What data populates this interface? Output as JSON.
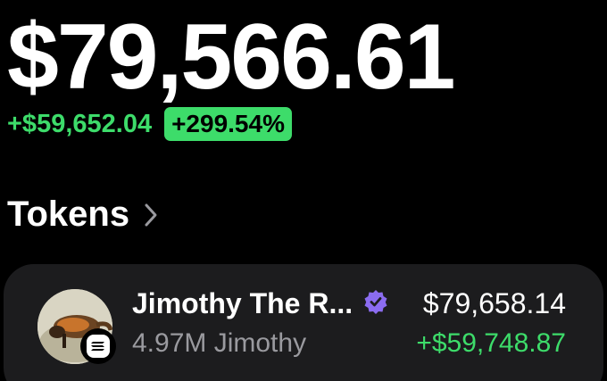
{
  "portfolio": {
    "balance": "$79,566.61",
    "change_amount": "+$59,652.04",
    "change_percent": "+299.54%"
  },
  "tokens_section": {
    "title": "Tokens",
    "chevron_icon": "chevron-right-icon"
  },
  "tokens": [
    {
      "name": "Jimothy The R...",
      "verified_icon": "verified-badge-icon",
      "chain_icon": "solana-icon",
      "amount": "4.97M Jimothy",
      "value": "$79,658.14",
      "change": "+$59,748.87"
    }
  ],
  "colors": {
    "background": "#000000",
    "positive": "#3ddc6a",
    "card": "#1c1c1e",
    "muted_text": "#9a9a9f",
    "verified": "#8b6cf0"
  }
}
